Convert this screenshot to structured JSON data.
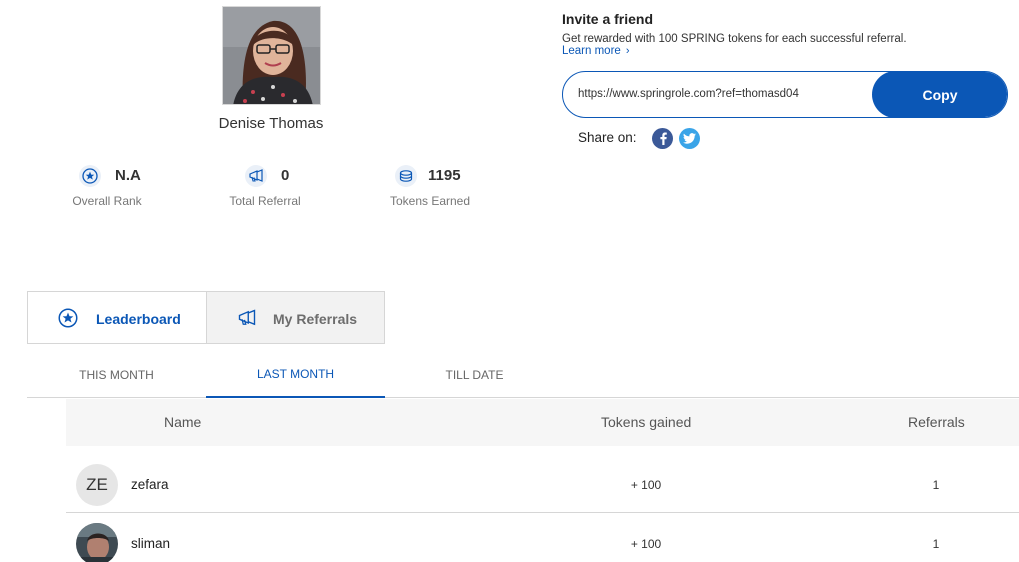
{
  "profile": {
    "name": "Denise Thomas",
    "stats": [
      {
        "icon": "star-badge-icon",
        "value": "N.A",
        "label": "Overall Rank"
      },
      {
        "icon": "megaphone-icon",
        "value": "0",
        "label": "Total Referral"
      },
      {
        "icon": "coins-icon",
        "value": "1195",
        "label": "Tokens Earned"
      }
    ]
  },
  "invite": {
    "title": "Invite a friend",
    "description": "Get rewarded with 100 SPRING tokens for each successful referral.",
    "learn_more": "Learn more",
    "referral_url": "https://www.springrole.com?ref=thomasd04",
    "copy_label": "Copy",
    "share_label": "Share on:",
    "share_icons": [
      "facebook-icon",
      "twitter-icon"
    ]
  },
  "tabs": [
    {
      "icon": "star-badge-icon",
      "label": "Leaderboard",
      "active": true
    },
    {
      "icon": "megaphone-icon",
      "label": "My Referrals",
      "active": false
    }
  ],
  "periods": [
    {
      "label": "THIS MONTH",
      "active": false
    },
    {
      "label": "LAST MONTH",
      "active": true
    },
    {
      "label": "TILL DATE",
      "active": false
    }
  ],
  "table": {
    "headers": {
      "name": "Name",
      "tokens": "Tokens gained",
      "referrals": "Referrals"
    },
    "rows": [
      {
        "avatar_initials": "ZE",
        "name": "zefara",
        "tokens": "+ 100",
        "referrals": "1"
      },
      {
        "avatar_initials": "",
        "name": "sliman",
        "tokens": "+ 100",
        "referrals": "1"
      }
    ]
  },
  "colors": {
    "accent": "#0b57b6",
    "facebook": "#3b5998",
    "twitter": "#3aa4e8"
  }
}
